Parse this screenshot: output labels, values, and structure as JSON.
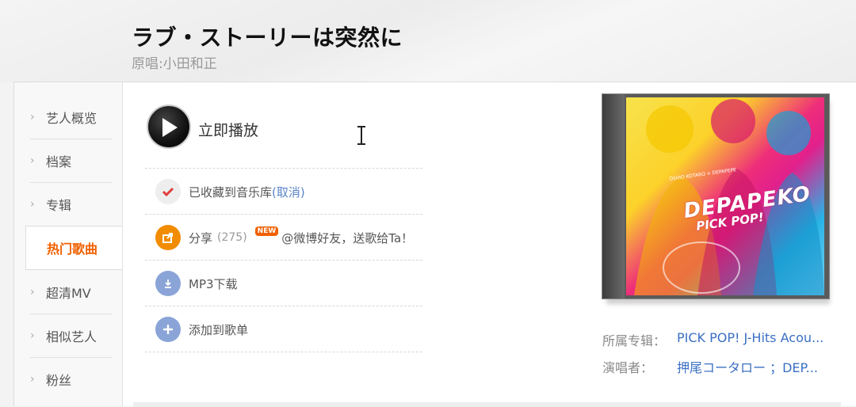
{
  "song": {
    "title": "ラブ・ストーリーは突然に",
    "original": "原唱:小田和正"
  },
  "sidebar": {
    "items": [
      {
        "label": "艺人概览"
      },
      {
        "label": "档案"
      },
      {
        "label": "专辑"
      },
      {
        "label": "热门歌曲",
        "active": true
      },
      {
        "label": "超清MV"
      },
      {
        "label": "相似艺人"
      },
      {
        "label": "粉丝"
      }
    ]
  },
  "player": {
    "play_label": "立即播放"
  },
  "actions": {
    "collected_label": "已收藏到音乐库",
    "cancel_label": "(取消)",
    "share_label": "分享",
    "share_count": "(275)",
    "new_badge": "NEW",
    "share_weibo": "@微博好友，送歌给Ta！",
    "mp3_label": "MP3下载",
    "add_playlist_label": "添加到歌单"
  },
  "album": {
    "cover_title": "DEPAPEKO",
    "cover_subtitle": "PICK POP!",
    "cover_small": "OSHIO KOTARO × DEPAPEPE"
  },
  "meta": {
    "album_label": "所属专辑：",
    "album_value": "PICK POP! J-Hits Acou...",
    "singer_label": "演唱者：",
    "singer_value": "押尾コータロー ；DEP..."
  },
  "colors": {
    "accent_orange": "#f06000",
    "link_blue": "#3a6fc4",
    "collect_red": "#e04040",
    "share_orange": "#f28c00",
    "action_blue": "#8aa4d8"
  },
  "icons": {
    "play": "play-icon",
    "collect": "check-icon",
    "share": "share-icon",
    "download": "download-icon",
    "add": "plus-icon",
    "cursor": "text-cursor-icon"
  }
}
